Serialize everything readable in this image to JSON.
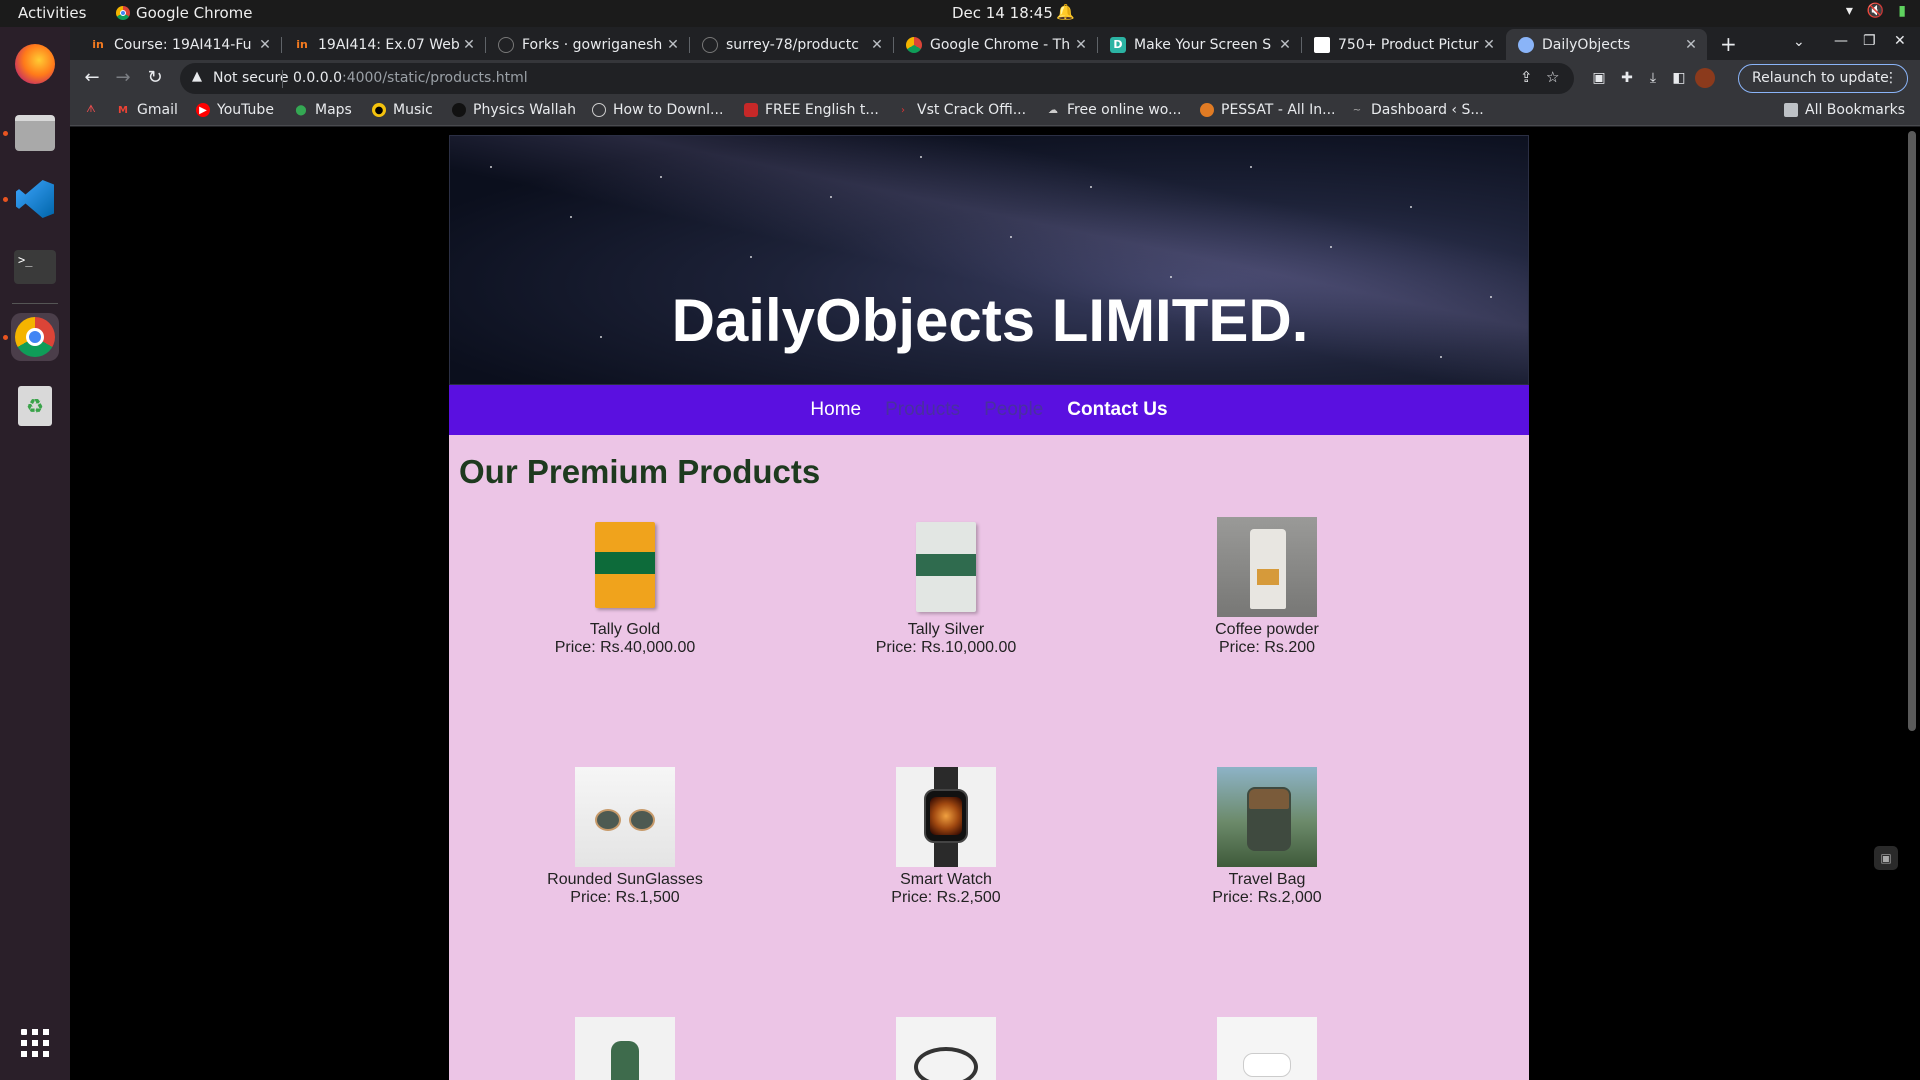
{
  "topbar": {
    "activities": "Activities",
    "app_name": "Google Chrome",
    "clock": "Dec 14  18:45"
  },
  "dock": {
    "items": [
      "firefox-icon",
      "files-icon",
      "vscode-icon",
      "terminal-icon",
      "chrome-icon",
      "trash-icon",
      "app-grid-icon"
    ]
  },
  "tabs": [
    {
      "title": "Course: 19AI414-Fu",
      "favicon": "in"
    },
    {
      "title": "19AI414: Ex.07 Web",
      "favicon": "in"
    },
    {
      "title": "Forks · gowriganesh",
      "favicon": "github"
    },
    {
      "title": "surrey-78/productc",
      "favicon": "github"
    },
    {
      "title": "Google Chrome - Th",
      "favicon": "chrome"
    },
    {
      "title": "Make Your Screen S",
      "favicon": "D"
    },
    {
      "title": "750+ Product Pictur",
      "favicon": "unsplash"
    },
    {
      "title": "DailyObjects",
      "favicon": "globe",
      "active": true
    }
  ],
  "toolbar": {
    "not_secure": "Not secure",
    "url_host": "0.0.0.0",
    "url_path": ":4000/static/products.html",
    "relaunch": "Relaunch to update"
  },
  "bookmarks": [
    {
      "label": "Gmail",
      "icon": "gmail"
    },
    {
      "label": "YouTube",
      "icon": "youtube"
    },
    {
      "label": "Maps",
      "icon": "maps"
    },
    {
      "label": "Music",
      "icon": "music"
    },
    {
      "label": "Physics Wallah",
      "icon": "pw"
    },
    {
      "label": "How to Downl...",
      "icon": "globe"
    },
    {
      "label": "FREE English t...",
      "icon": "book"
    },
    {
      "label": "Vst Crack Offi...",
      "icon": "arrow"
    },
    {
      "label": "Free online wo...",
      "icon": "cloud"
    },
    {
      "label": "PESSAT - All In...",
      "icon": "circle"
    },
    {
      "label": "Dashboard ‹ S...",
      "icon": "wp"
    }
  ],
  "all_bookmarks": "All Bookmarks",
  "site": {
    "title": "DailyObjects LIMITED.",
    "nav": {
      "home": "Home",
      "products": "Products",
      "people": "People",
      "contact": "Contact Us"
    },
    "heading": "Our Premium Products",
    "products": [
      {
        "name": "Tally Gold",
        "price": "Price: Rs.40,000.00"
      },
      {
        "name": "Tally Silver",
        "price": "Price: Rs.10,000.00"
      },
      {
        "name": "Coffee powder",
        "price": "Price: Rs.200"
      },
      {
        "name": "Rounded SunGlasses",
        "price": "Price: Rs.1,500"
      },
      {
        "name": "Smart Watch",
        "price": "Price: Rs.2,500"
      },
      {
        "name": "Travel Bag",
        "price": "Price: Rs.2,000"
      }
    ]
  },
  "colors": {
    "nav_bg": "#5a10e0",
    "page_bg": "#ecc5e6",
    "heading": "#1e3a1f"
  }
}
